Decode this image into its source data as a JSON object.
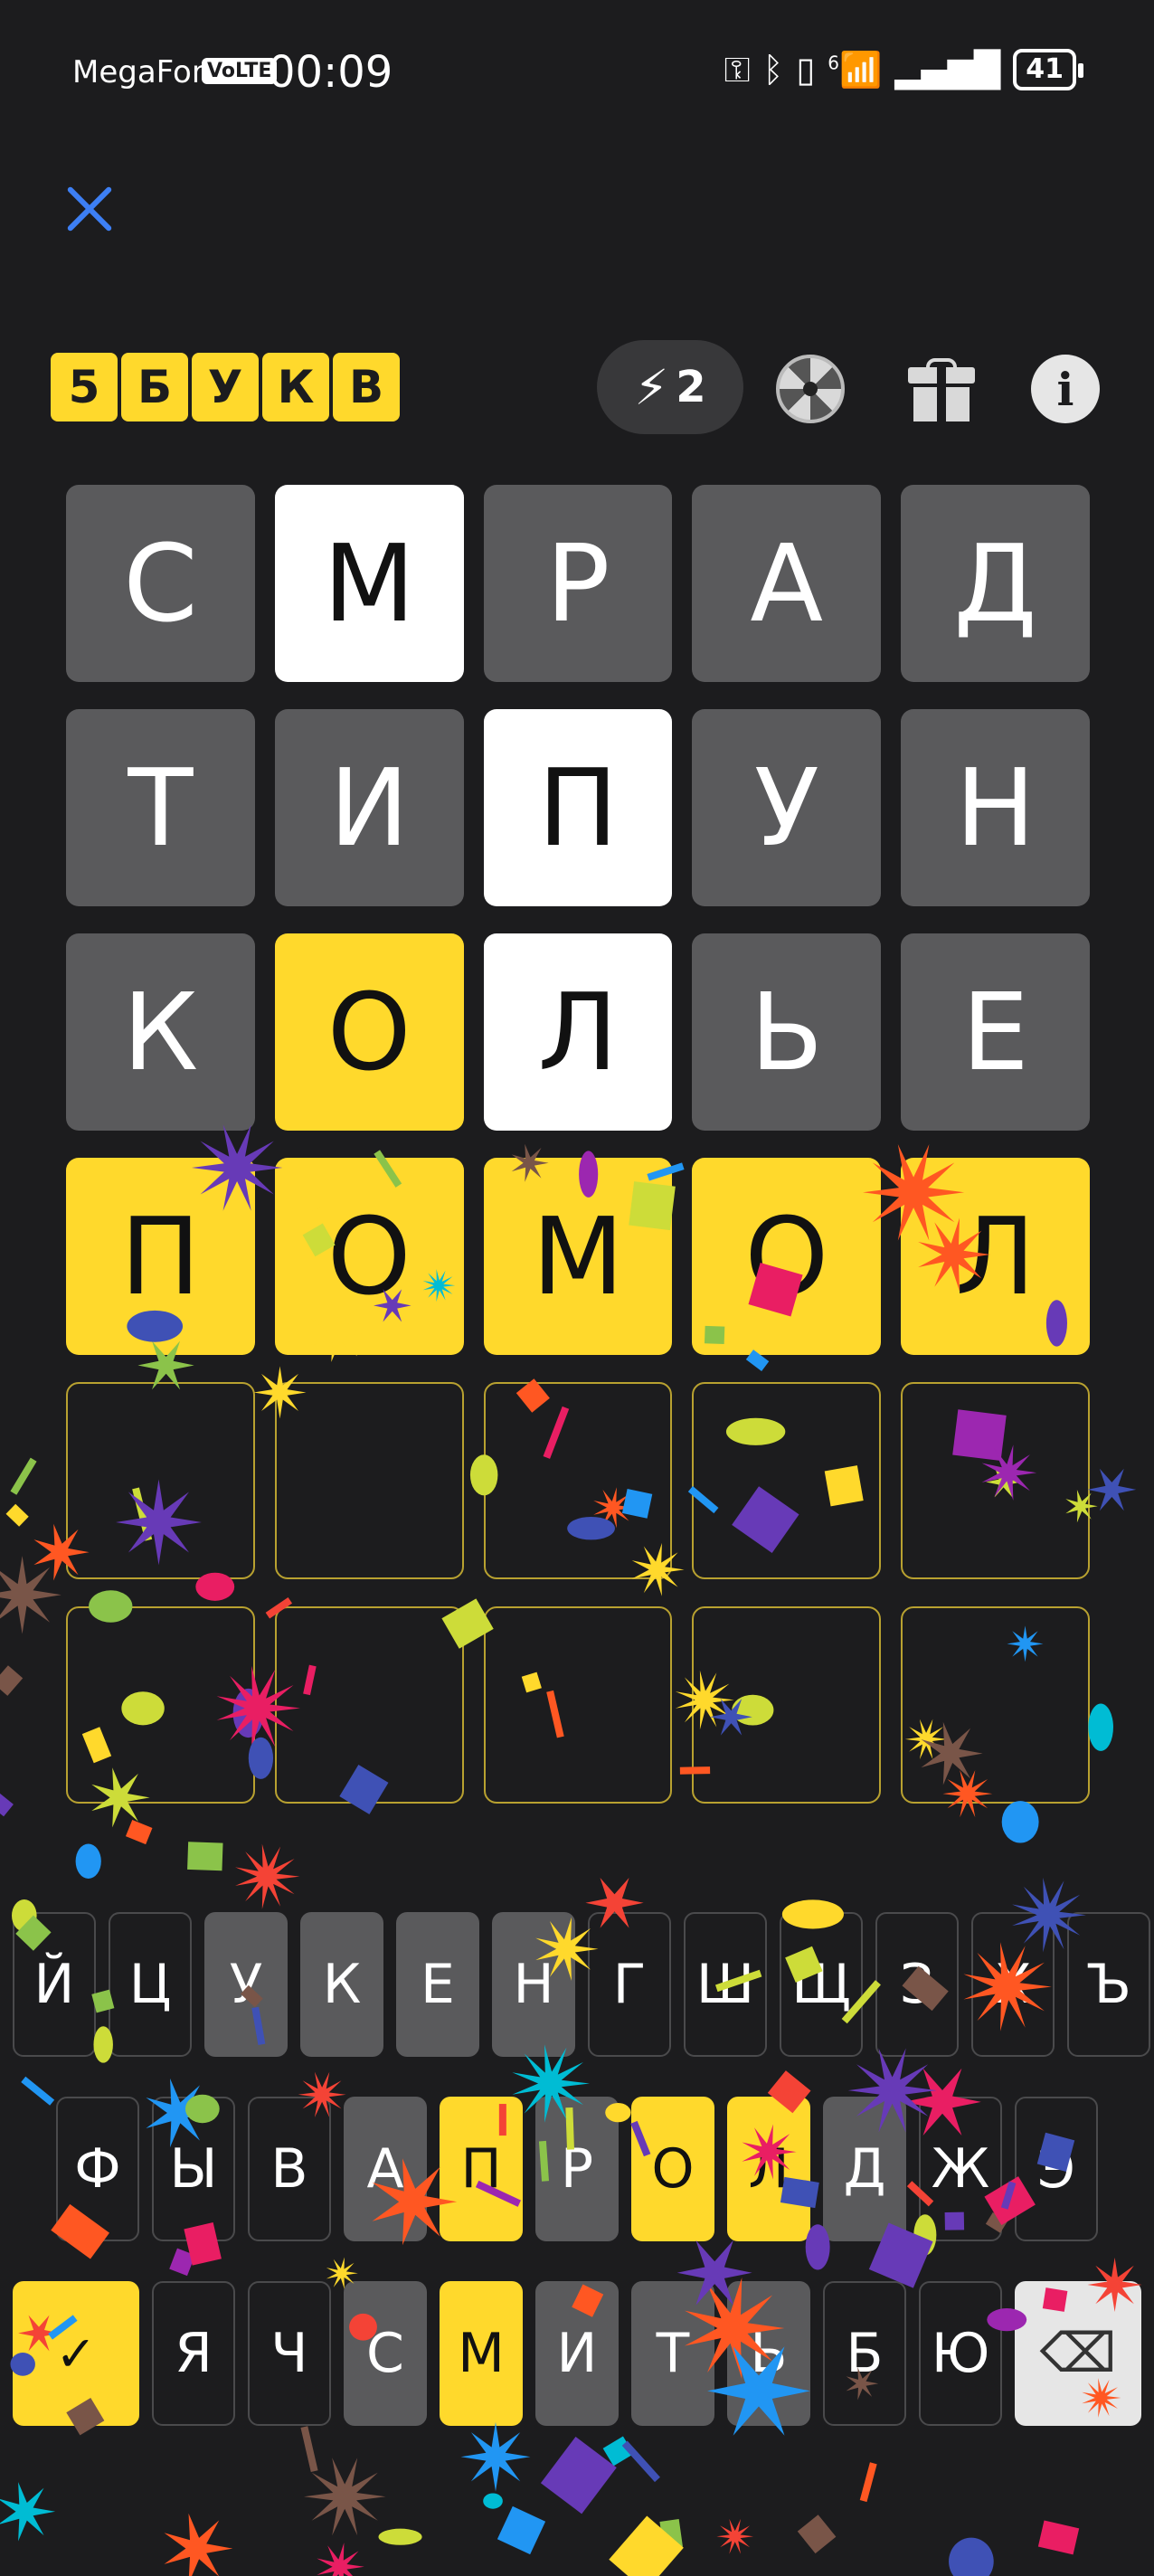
{
  "status_bar": {
    "carrier": "MegaFon",
    "volte": "VoLTE",
    "time": "00:09",
    "network": "6",
    "battery": "41"
  },
  "header": {
    "logo_letters": [
      "5",
      "Б",
      "У",
      "К",
      "В"
    ],
    "hint_count": "2"
  },
  "colors": {
    "accent": "#ffd92c",
    "absent": "#5a5a5c",
    "present_white": "#ffffff",
    "close": "#3d7ff4"
  },
  "board": [
    [
      {
        "l": "С",
        "s": "gray"
      },
      {
        "l": "М",
        "s": "white"
      },
      {
        "l": "Р",
        "s": "gray"
      },
      {
        "l": "А",
        "s": "gray"
      },
      {
        "l": "Д",
        "s": "gray"
      }
    ],
    [
      {
        "l": "Т",
        "s": "gray"
      },
      {
        "l": "И",
        "s": "gray"
      },
      {
        "l": "П",
        "s": "white"
      },
      {
        "l": "У",
        "s": "gray"
      },
      {
        "l": "Н",
        "s": "gray"
      }
    ],
    [
      {
        "l": "К",
        "s": "gray"
      },
      {
        "l": "О",
        "s": "yellow"
      },
      {
        "l": "Л",
        "s": "white"
      },
      {
        "l": "Ь",
        "s": "gray"
      },
      {
        "l": "Е",
        "s": "gray"
      }
    ],
    [
      {
        "l": "П",
        "s": "yellow"
      },
      {
        "l": "О",
        "s": "yellow"
      },
      {
        "l": "М",
        "s": "yellow"
      },
      {
        "l": "О",
        "s": "yellow"
      },
      {
        "l": "Л",
        "s": "yellow"
      }
    ],
    [
      {
        "l": "",
        "s": "empty"
      },
      {
        "l": "",
        "s": "empty"
      },
      {
        "l": "",
        "s": "empty"
      },
      {
        "l": "",
        "s": "empty"
      },
      {
        "l": "",
        "s": "empty"
      }
    ],
    [
      {
        "l": "",
        "s": "empty"
      },
      {
        "l": "",
        "s": "empty"
      },
      {
        "l": "",
        "s": "empty"
      },
      {
        "l": "",
        "s": "empty"
      },
      {
        "l": "",
        "s": "empty"
      }
    ]
  ],
  "keyboard": {
    "row1": [
      {
        "l": "Й",
        "s": "none"
      },
      {
        "l": "Ц",
        "s": "none"
      },
      {
        "l": "У",
        "s": "gray"
      },
      {
        "l": "К",
        "s": "gray"
      },
      {
        "l": "Е",
        "s": "gray"
      },
      {
        "l": "Н",
        "s": "gray"
      },
      {
        "l": "Г",
        "s": "none"
      },
      {
        "l": "Ш",
        "s": "none"
      },
      {
        "l": "Щ",
        "s": "none"
      },
      {
        "l": "З",
        "s": "none"
      },
      {
        "l": "Х",
        "s": "none"
      },
      {
        "l": "Ъ",
        "s": "none"
      }
    ],
    "row2": [
      {
        "l": "Ф",
        "s": "none"
      },
      {
        "l": "Ы",
        "s": "none"
      },
      {
        "l": "В",
        "s": "none"
      },
      {
        "l": "А",
        "s": "gray"
      },
      {
        "l": "П",
        "s": "yellow"
      },
      {
        "l": "Р",
        "s": "gray"
      },
      {
        "l": "О",
        "s": "yellow"
      },
      {
        "l": "Л",
        "s": "yellow"
      },
      {
        "l": "Д",
        "s": "gray"
      },
      {
        "l": "Ж",
        "s": "none"
      },
      {
        "l": "Э",
        "s": "none"
      }
    ],
    "row3": [
      {
        "l": "Я",
        "s": "none"
      },
      {
        "l": "Ч",
        "s": "none"
      },
      {
        "l": "С",
        "s": "gray"
      },
      {
        "l": "М",
        "s": "yellow"
      },
      {
        "l": "И",
        "s": "gray"
      },
      {
        "l": "Т",
        "s": "gray"
      },
      {
        "l": "Ь",
        "s": "gray"
      },
      {
        "l": "Б",
        "s": "none"
      },
      {
        "l": "Ю",
        "s": "none"
      }
    ],
    "enter": "✓",
    "backspace": "⌫"
  }
}
